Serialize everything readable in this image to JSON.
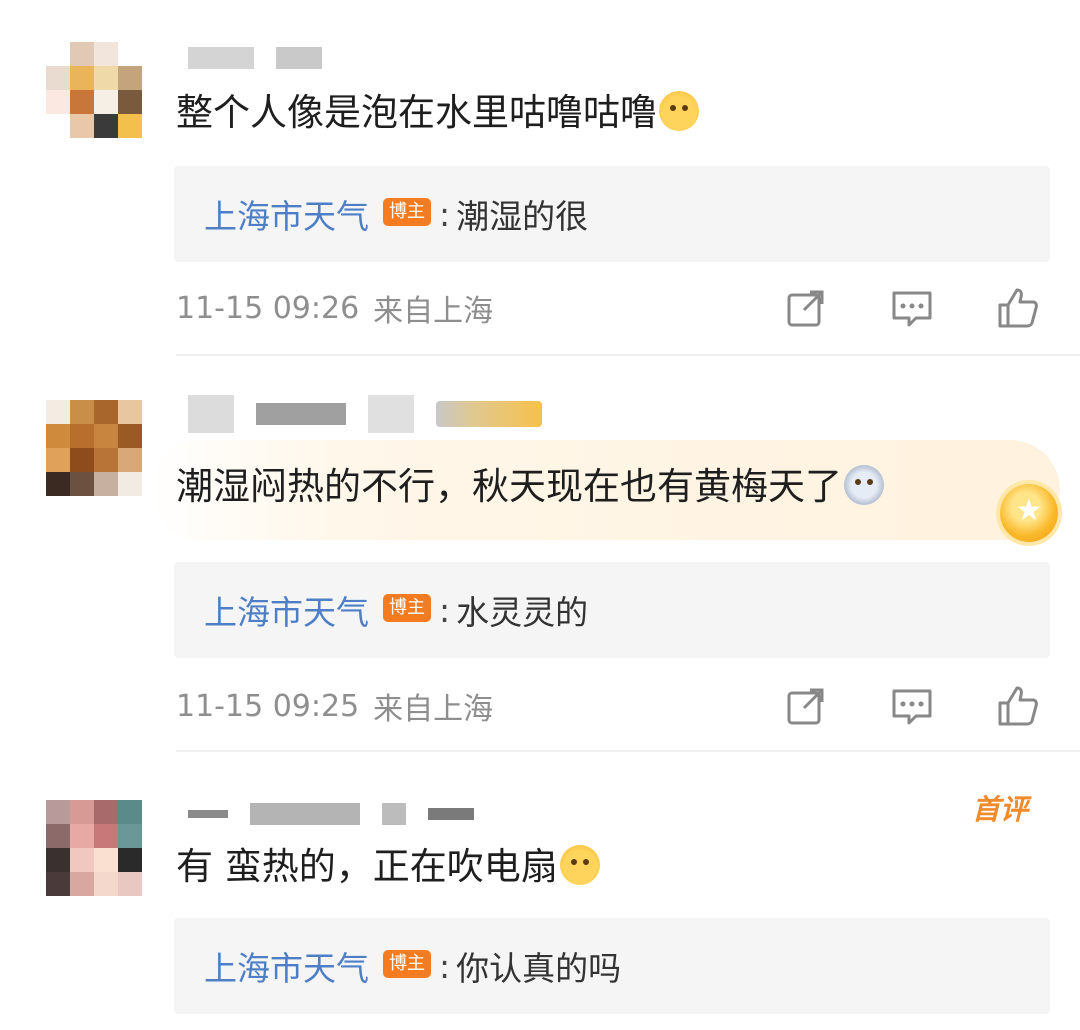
{
  "comments": [
    {
      "text": "整个人像是泡在水里咕噜咕噜",
      "emoji": "sweat-emoji",
      "reply": {
        "author": "上海市天气",
        "tag": "博主",
        "separator": ":",
        "text": "潮湿的很"
      },
      "time": "11-15 09:26",
      "location": "来自上海"
    },
    {
      "text": "潮湿闷热的不行，秋天现在也有黄梅天了",
      "emoji": "dizzy-emoji",
      "reply": {
        "author": "上海市天气",
        "tag": "博主",
        "separator": ":",
        "text": "水灵灵的"
      },
      "time": "11-15 09:25",
      "location": "来自上海"
    },
    {
      "text": "有 蛮热的，正在吹电扇",
      "emoji": "crying-emoji",
      "first_comment_tag": "首评",
      "reply": {
        "author": "上海市天气",
        "tag": "博主",
        "separator": ":",
        "text": "你认真的吗"
      }
    }
  ],
  "icons": {
    "share": "share-icon",
    "comment": "comment-icon",
    "like": "thumbs-up-icon",
    "medal": "medal-icon"
  },
  "colors": {
    "reply_author": "#4e7fc6",
    "blogger_tag": "#f47b20",
    "meta_text": "#8e8e8e",
    "reply_bg": "#f5f5f5",
    "first_comment": "#f08a2a"
  }
}
